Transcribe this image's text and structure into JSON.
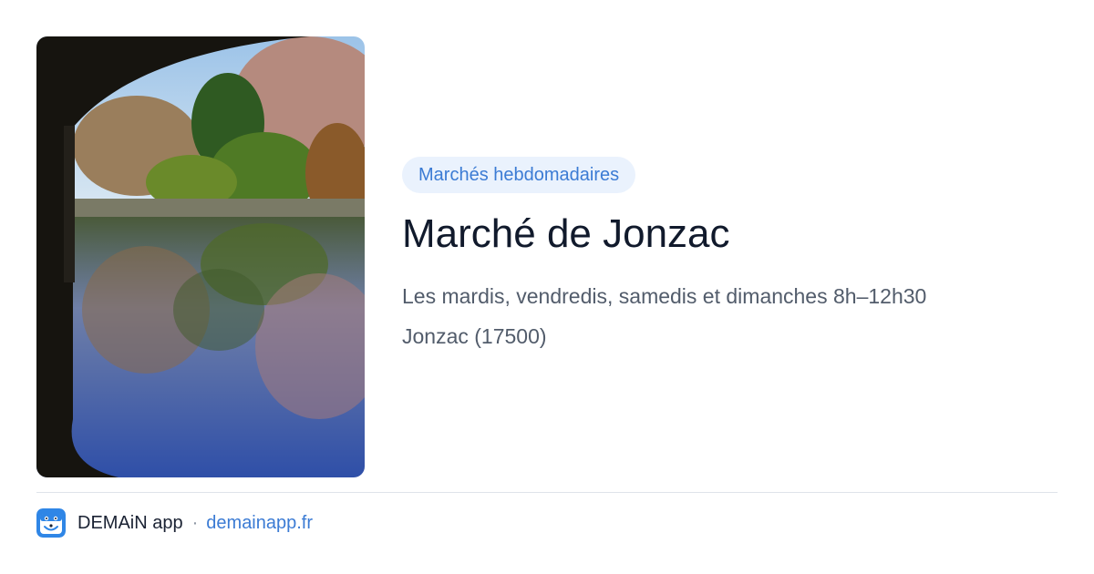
{
  "card": {
    "category_chip": "Marchés hebdomadaires",
    "title": "Marché de Jonzac",
    "schedule": "Les mardis, vendredis, samedis et dimanches 8h–12h30",
    "location": "Jonzac (17500)"
  },
  "footer": {
    "app_name": "DEMAiN app",
    "separator": "·",
    "site_link": "demainapp.fr",
    "app_icon": "demain-mascot-icon"
  },
  "colors": {
    "accent": "#3b7bd4",
    "chip_bg": "#eaf2fd",
    "title": "#111a2c",
    "body_text": "#525c6b"
  }
}
